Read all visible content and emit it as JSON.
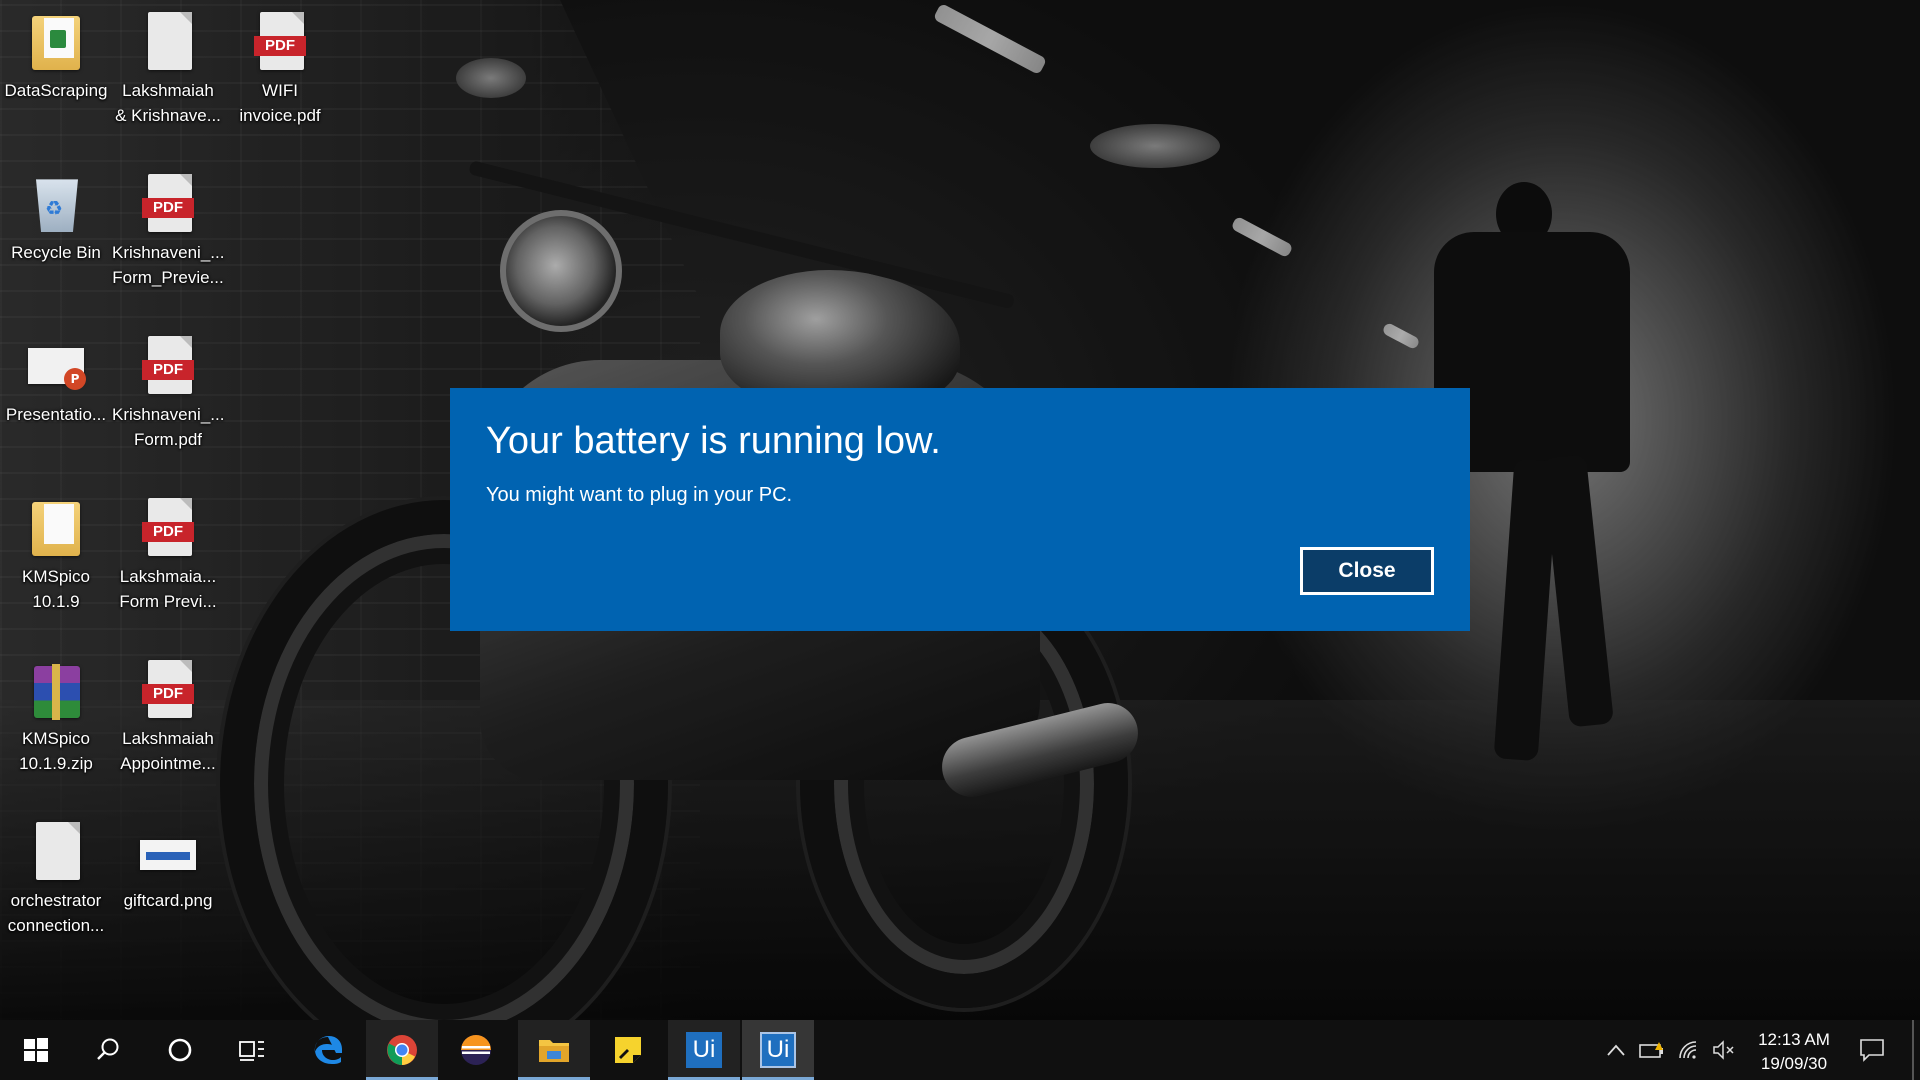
{
  "desktop": {
    "icons": [
      {
        "label_line1": "DataScraping",
        "label_line2": "",
        "type": "folder"
      },
      {
        "label_line1": "Lakshmaiah",
        "label_line2": "& Krishnave...",
        "type": "document"
      },
      {
        "label_line1": "WIFI",
        "label_line2": "invoice.pdf",
        "type": "pdf"
      },
      {
        "label_line1": "Recycle Bin",
        "label_line2": "",
        "type": "recycle-bin"
      },
      {
        "label_line1": "Krishnaveni_...",
        "label_line2": "Form_Previe...",
        "type": "pdf"
      },
      {
        "label_line1": "Presentatio...",
        "label_line2": "",
        "type": "powerpoint"
      },
      {
        "label_line1": "Krishnaveni_...",
        "label_line2": "Form.pdf",
        "type": "pdf"
      },
      {
        "label_line1": "KMSpico",
        "label_line2": "10.1.9",
        "type": "folder"
      },
      {
        "label_line1": "Lakshmaia...",
        "label_line2": "Form Previ...",
        "type": "pdf"
      },
      {
        "label_line1": "KMSpico",
        "label_line2": "10.1.9.zip",
        "type": "winrar"
      },
      {
        "label_line1": "Lakshmaiah",
        "label_line2": "Appointme...",
        "type": "pdf"
      },
      {
        "label_line1": "orchestrator",
        "label_line2": "connection...",
        "type": "document"
      },
      {
        "label_line1": "giftcard.png",
        "label_line2": "",
        "type": "image"
      }
    ],
    "pdf_tag": "PDF",
    "ppt_badge": "P"
  },
  "dialog": {
    "title": "Your battery is running low.",
    "message": "You might want to plug in your PC.",
    "close_label": "Close",
    "background_color": "#0063b1"
  },
  "taskbar": {
    "pinned": [
      {
        "name": "start-button",
        "icon": "windows-logo-icon"
      },
      {
        "name": "search-button",
        "icon": "search-icon"
      },
      {
        "name": "cortana-button",
        "icon": "cortana-circle-icon"
      },
      {
        "name": "task-view-button",
        "icon": "task-view-icon"
      },
      {
        "name": "edge-button",
        "icon": "edge-icon"
      },
      {
        "name": "chrome-button",
        "icon": "chrome-icon",
        "running": true
      },
      {
        "name": "eclipse-button",
        "icon": "eclipse-icon"
      },
      {
        "name": "file-explorer-button",
        "icon": "folder-icon",
        "running": true
      },
      {
        "name": "sticky-notes-button",
        "icon": "sticky-notes-icon"
      },
      {
        "name": "uipath-studio-button",
        "icon": "uipath-icon",
        "label": "Ui",
        "running": true
      },
      {
        "name": "uipath-robot-button",
        "icon": "uipath-icon",
        "label": "Ui",
        "running": true,
        "active": true
      }
    ],
    "tray": [
      "chevron-up-icon",
      "battery-warning-icon",
      "wifi-icon",
      "volume-muted-icon"
    ],
    "clock": {
      "time": "12:13 AM",
      "date": "19/09/30"
    },
    "accent_color": "#7aa8d6"
  }
}
